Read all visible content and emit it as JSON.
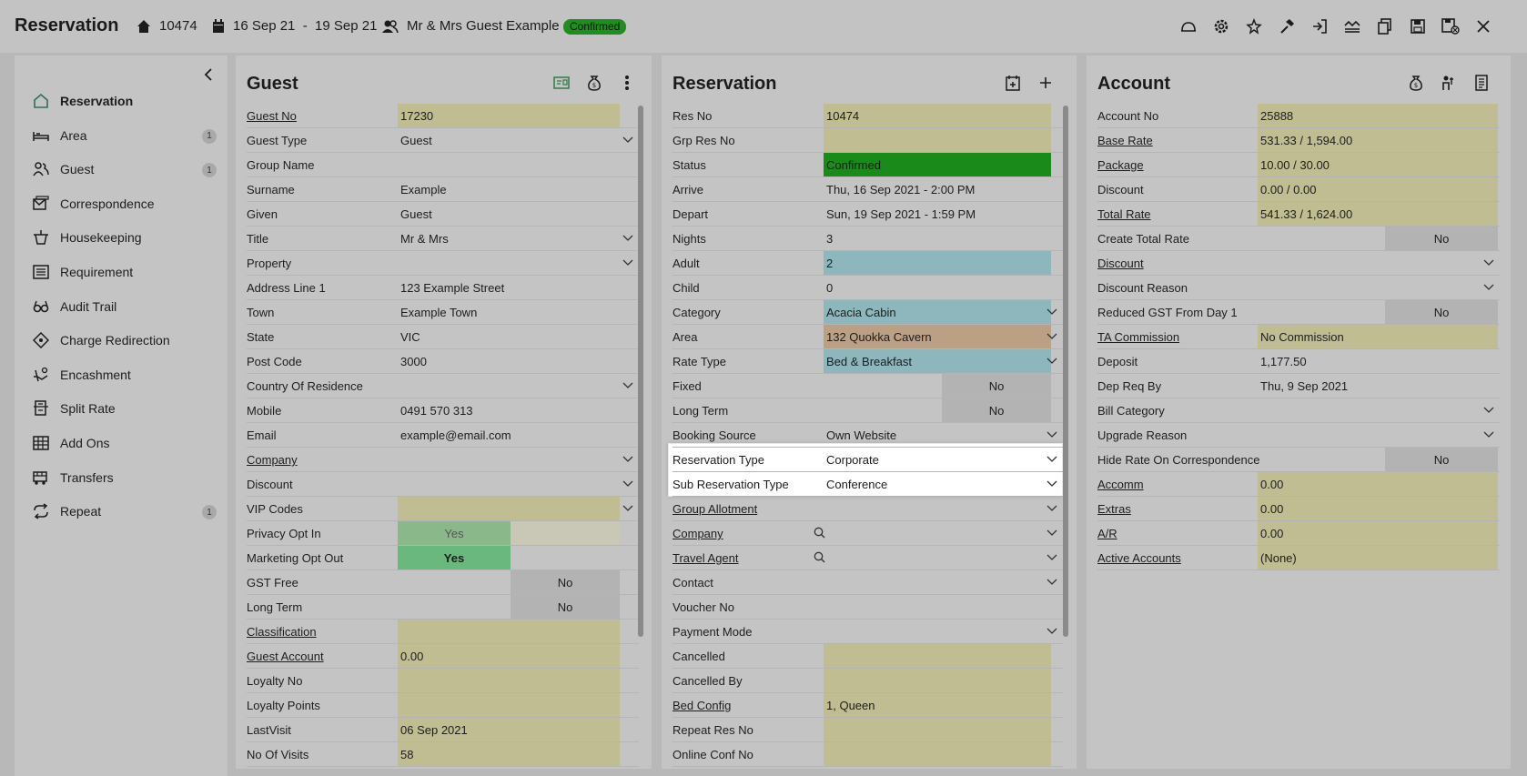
{
  "header": {
    "title": "Reservation",
    "res_no": "10474",
    "dates": "16 Sep 21  -  19 Sep 21",
    "guest": "Mr & Mrs Guest Example",
    "status": "Confirmed"
  },
  "sidebar": {
    "items": [
      {
        "label": "Reservation",
        "icon": "home-icon",
        "count": ""
      },
      {
        "label": "Area",
        "icon": "bed-icon",
        "count": "1"
      },
      {
        "label": "Guest",
        "icon": "users-icon",
        "count": "1"
      },
      {
        "label": "Correspondence",
        "icon": "mail-icon",
        "count": ""
      },
      {
        "label": "Housekeeping",
        "icon": "bucket-icon",
        "count": ""
      },
      {
        "label": "Requirement",
        "icon": "list-icon",
        "count": ""
      },
      {
        "label": "Audit Trail",
        "icon": "glasses-icon",
        "count": ""
      },
      {
        "label": "Charge Redirection",
        "icon": "tag-icon",
        "count": ""
      },
      {
        "label": "Encashment",
        "icon": "hand-coin-icon",
        "count": ""
      },
      {
        "label": "Split Rate",
        "icon": "split-icon",
        "count": ""
      },
      {
        "label": "Add Ons",
        "icon": "grid-icon",
        "count": ""
      },
      {
        "label": "Transfers",
        "icon": "bus-icon",
        "count": ""
      },
      {
        "label": "Repeat",
        "icon": "repeat-icon",
        "count": "1"
      }
    ]
  },
  "guest": {
    "title": "Guest",
    "rows": [
      {
        "label": "Guest No",
        "value": "17230"
      },
      {
        "label": "Guest Type",
        "value": "Guest"
      },
      {
        "label": "Group Name",
        "value": ""
      },
      {
        "label": "Surname",
        "value": "Example"
      },
      {
        "label": "Given",
        "value": "Guest"
      },
      {
        "label": "Title",
        "value": "Mr & Mrs"
      },
      {
        "label": "Property",
        "value": ""
      },
      {
        "label": "Address Line 1",
        "value": "123 Example Street"
      },
      {
        "label": "Town",
        "value": "Example Town"
      },
      {
        "label": "State",
        "value": "VIC"
      },
      {
        "label": "Post Code",
        "value": "3000"
      },
      {
        "label": "Country Of Residence",
        "value": ""
      },
      {
        "label": "Mobile",
        "value": "0491 570 313"
      },
      {
        "label": "Email",
        "value": "example@email.com"
      },
      {
        "label": "Company",
        "value": ""
      },
      {
        "label": "Discount",
        "value": ""
      },
      {
        "label": "VIP Codes",
        "value": ""
      },
      {
        "label": "Privacy Opt In",
        "value": "Yes"
      },
      {
        "label": "Marketing Opt Out",
        "value": "Yes"
      },
      {
        "label": "GST Free",
        "value": "No"
      },
      {
        "label": "Long Term",
        "value": "No"
      },
      {
        "label": "Classification",
        "value": ""
      },
      {
        "label": "Guest Account",
        "value": "0.00"
      },
      {
        "label": "Loyalty No",
        "value": ""
      },
      {
        "label": "Loyalty Points",
        "value": ""
      },
      {
        "label": "LastVisit",
        "value": "06 Sep 2021"
      },
      {
        "label": "No Of Visits",
        "value": "58"
      }
    ]
  },
  "reservation": {
    "title": "Reservation",
    "rows": [
      {
        "label": "Res No",
        "value": "10474"
      },
      {
        "label": "Grp Res No",
        "value": ""
      },
      {
        "label": "Status",
        "value": "Confirmed"
      },
      {
        "label": "Arrive",
        "value": "Thu, 16 Sep 2021 - 2:00 PM"
      },
      {
        "label": "Depart",
        "value": "Sun, 19 Sep 2021 - 1:59 PM"
      },
      {
        "label": "Nights",
        "value": "3"
      },
      {
        "label": "Adult",
        "value": "2"
      },
      {
        "label": "Child",
        "value": "0"
      },
      {
        "label": "Category",
        "value": "Acacia Cabin"
      },
      {
        "label": "Area",
        "value": "132 Quokka Cavern"
      },
      {
        "label": "Rate Type",
        "value": "Bed & Breakfast"
      },
      {
        "label": "Fixed",
        "value": "No"
      },
      {
        "label": "Long Term",
        "value": "No"
      },
      {
        "label": "Booking Source",
        "value": "Own Website"
      },
      {
        "label": "Reservation Type",
        "value": "Corporate"
      },
      {
        "label": "Sub Reservation Type",
        "value": "Conference"
      },
      {
        "label": "Group Allotment",
        "value": ""
      },
      {
        "label": "Company",
        "value": ""
      },
      {
        "label": "Travel Agent",
        "value": ""
      },
      {
        "label": "Contact",
        "value": ""
      },
      {
        "label": "Voucher No",
        "value": ""
      },
      {
        "label": "Payment Mode",
        "value": ""
      },
      {
        "label": "Cancelled",
        "value": ""
      },
      {
        "label": "Cancelled By",
        "value": ""
      },
      {
        "label": "Bed Config",
        "value": "1, Queen"
      },
      {
        "label": "Repeat Res No",
        "value": ""
      },
      {
        "label": "Online Conf No",
        "value": ""
      }
    ]
  },
  "account": {
    "title": "Account",
    "rows": [
      {
        "label": "Account No",
        "value": "25888"
      },
      {
        "label": "Base Rate",
        "value": "531.33 / 1,594.00"
      },
      {
        "label": "Package",
        "value": "10.00 / 30.00"
      },
      {
        "label": "Discount",
        "value": "0.00 / 0.00"
      },
      {
        "label": "Total Rate",
        "value": "541.33 / 1,624.00"
      },
      {
        "label": "Create Total Rate",
        "value": "No"
      },
      {
        "label": "Discount",
        "value": ""
      },
      {
        "label": "Discount Reason",
        "value": ""
      },
      {
        "label": "Reduced GST From Day 1",
        "value": "No"
      },
      {
        "label": "TA Commission",
        "value": "No Commission"
      },
      {
        "label": "Deposit",
        "value": "1,177.50"
      },
      {
        "label": "Dep Req By",
        "value": "Thu, 9 Sep 2021"
      },
      {
        "label": "Bill Category",
        "value": ""
      },
      {
        "label": "Upgrade Reason",
        "value": ""
      },
      {
        "label": "Hide Rate On Correspondence",
        "value": "No"
      },
      {
        "label": "Accomm",
        "value": "0.00"
      },
      {
        "label": "Extras",
        "value": "0.00"
      },
      {
        "label": "A/R",
        "value": "0.00"
      },
      {
        "label": "Active Accounts",
        "value": "(None)"
      }
    ]
  },
  "colors": {
    "background": "#b8b8b8",
    "panel": "#c4c4c4",
    "yellow_field": "#c0bd92",
    "confirmed_green": "#1a8a1a",
    "blue_field": "#8db7bc",
    "orange_field": "#bba084",
    "highlight": "#ffffff"
  }
}
